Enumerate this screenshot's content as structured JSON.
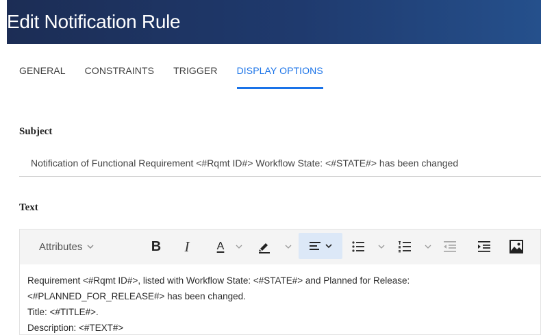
{
  "header": {
    "title": "Edit Notification Rule"
  },
  "tabs": [
    {
      "label": "GENERAL",
      "active": false
    },
    {
      "label": "CONSTRAINTS",
      "active": false
    },
    {
      "label": "TRIGGER",
      "active": false
    },
    {
      "label": "DISPLAY OPTIONS",
      "active": true
    }
  ],
  "subject": {
    "label": "Subject",
    "value": "Notification of Functional Requirement <#Rqmt ID#> Workflow State: <#STATE#> has been changed"
  },
  "text": {
    "label": "Text",
    "toolbar": {
      "attributes_label": "Attributes",
      "bold_label": "B",
      "italic_label": "I",
      "font_color_label": "A"
    },
    "body_lines": [
      "Requirement <#Rqmt ID#>, listed with Workflow State: <#STATE#> and Planned for Release:",
      "<#PLANNED_FOR_RELEASE#> has been changed.",
      "Title: <#TITLE#>.",
      "Description: <#TEXT#>"
    ]
  },
  "colors": {
    "accent": "#1a73e8",
    "header_start": "#1c2d55",
    "header_end": "#25508c",
    "active_button_bg": "#dce8f7"
  }
}
